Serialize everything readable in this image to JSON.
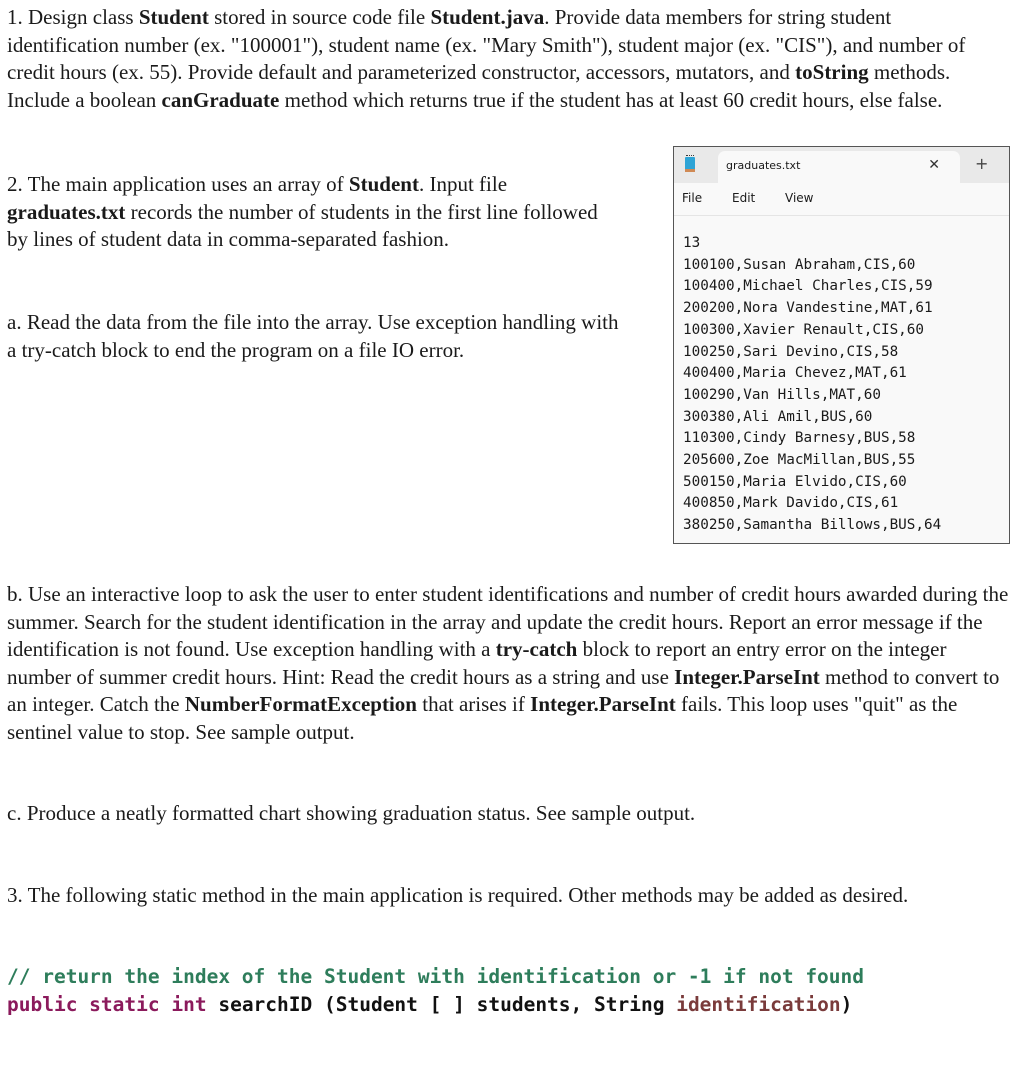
{
  "section1": {
    "segments": [
      {
        "t": "1.  Design class ",
        "b": false
      },
      {
        "t": "Student",
        "b": true
      },
      {
        "t": " stored in source code file ",
        "b": false
      },
      {
        "t": "Student.java",
        "b": true
      },
      {
        "t": ".  Provide data members for string student identification number (ex. \"100001\"), student name (ex. \"Mary Smith\"), student major (ex. \"CIS\"), and number of credit hours (ex. 55). Provide default and parameterized constructor, accessors, mutators, and ",
        "b": false
      },
      {
        "t": "toString",
        "b": true
      },
      {
        "t": "  methods. Include a boolean ",
        "b": false
      },
      {
        "t": "canGraduate",
        "b": true
      },
      {
        "t": " method which returns true if the student has at least 60 credit hours, else false.",
        "b": false
      }
    ]
  },
  "section2": {
    "segments": [
      {
        "t": "2.  The main application uses an array of ",
        "b": false
      },
      {
        "t": "Student",
        "b": true
      },
      {
        "t": ". Input file ",
        "b": false
      },
      {
        "t": "graduates.txt",
        "b": true
      },
      {
        "t": " records the number of students in the first line followed by lines of student data in comma-separated fashion.",
        "b": false
      }
    ]
  },
  "section2a": {
    "segments": [
      {
        "t": "a.  Read the data from the file into the array. Use exception handling with a try-catch block to end the program on a file IO error.",
        "b": false
      }
    ]
  },
  "section2b": {
    "segments": [
      {
        "t": "b.  Use an interactive loop to ask the user to enter student identifications and number of credit hours awarded during the summer.  Search for the student identification in the array and update the credit hours.  Report an error message if the identification is not found.  Use exception handling with a ",
        "b": false
      },
      {
        "t": "try-catch",
        "b": true
      },
      {
        "t": " block to report an entry error on the integer number of summer credit hours. Hint: Read the credit hours as a string and use ",
        "b": false
      },
      {
        "t": "Integer.ParseInt",
        "b": true
      },
      {
        "t": " method to convert to an integer. Catch the ",
        "b": false
      },
      {
        "t": "NumberFormatException",
        "b": true
      },
      {
        "t": " that arises if ",
        "b": false
      },
      {
        "t": "Integer.ParseInt",
        "b": true
      },
      {
        "t": " fails. This loop uses \"quit\" as the sentinel value to stop.  See sample output.",
        "b": false
      }
    ]
  },
  "section2c": {
    "segments": [
      {
        "t": "c.  Produce a neatly formatted chart showing graduation status. See sample output.",
        "b": false
      }
    ]
  },
  "section3": {
    "segments": [
      {
        "t": "3. The following static method in the main application is required.  Other methods may be added as desired.",
        "b": false
      }
    ]
  },
  "code": {
    "comment": "// return the index of the Student with identification or -1 if not found",
    "signature": {
      "modifiers": "public static int",
      "method": " searchID (Student [ ] students, String ",
      "param": "identification",
      "close": ")"
    }
  },
  "notepad": {
    "tab_title": "graduates.txt",
    "close_glyph": "✕",
    "new_tab_glyph": "+",
    "menu": [
      "File",
      "Edit",
      "View"
    ],
    "lines": [
      "13",
      "100100,Susan Abraham,CIS,60",
      "100400,Michael Charles,CIS,59",
      "200200,Nora Vandestine,MAT,61",
      "100300,Xavier Renault,CIS,60",
      "100250,Sari Devino,CIS,58",
      "400400,Maria Chevez,MAT,61",
      "100290,Van Hills,MAT,60",
      "300380,Ali Amil,BUS,60",
      "110300,Cindy Barnesy,BUS,58",
      "205600,Zoe MacMillan,BUS,55",
      "500150,Maria Elvido,CIS,60",
      "400850,Mark Davido,CIS,61",
      "380250,Samantha Billows,BUS,64"
    ]
  }
}
